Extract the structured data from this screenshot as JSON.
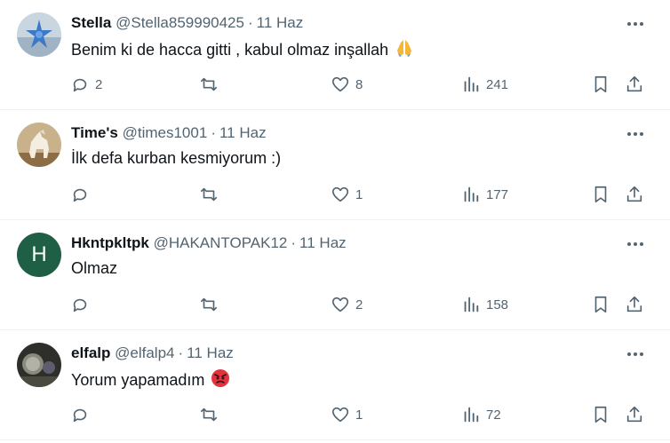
{
  "tweets": [
    {
      "name": "Stella",
      "handle": "@Stella859990425",
      "date": "11 Haz",
      "text": "Benim ki de hacca gitti , kabul olmaz inşallah",
      "emoji": "praying-hands",
      "replies": "2",
      "retweets": "",
      "likes": "8",
      "views": "241",
      "avatar": {
        "kind": "image",
        "icon": "starfish-photo",
        "color": "#7fa9c9"
      }
    },
    {
      "name": "Time's",
      "handle": "@times1001",
      "date": "11 Haz",
      "text": "İlk defa kurban kesmiyorum :)",
      "replies": "",
      "retweets": "",
      "likes": "1",
      "views": "177",
      "avatar": {
        "kind": "image",
        "icon": "horse-photo",
        "color": "#a48358"
      }
    },
    {
      "name": "Hkntpkltpk",
      "handle": "@HAKANTOPAK12",
      "date": "11 Haz",
      "text": "Olmaz",
      "replies": "",
      "retweets": "",
      "likes": "2",
      "views": "158",
      "avatar": {
        "kind": "letter",
        "letter": "H",
        "color": "#1e5f45"
      }
    },
    {
      "name": "elfalp",
      "handle": "@elfalp4",
      "date": "11 Haz",
      "text": "Yorum yapamadım",
      "emoji": "angry-face",
      "replies": "",
      "retweets": "",
      "likes": "1",
      "views": "72",
      "avatar": {
        "kind": "image",
        "icon": "dark-photo",
        "color": "#2e2e2a"
      }
    }
  ],
  "colors": {
    "text": "#0f1419",
    "muted": "#536471",
    "divider": "#eff3f4"
  }
}
